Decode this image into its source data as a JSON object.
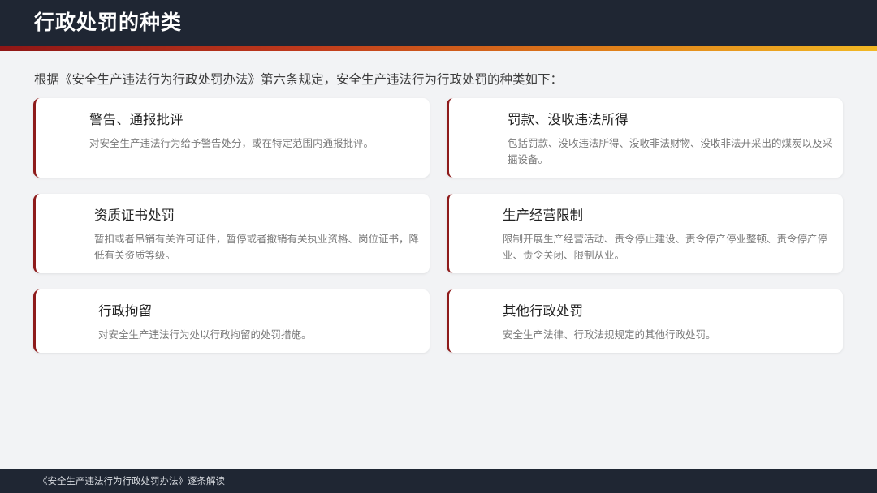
{
  "header": {
    "title": "行政处罚的种类"
  },
  "intro": {
    "text": "根据《安全生产违法行为行政处罚办法》第六条规定，安全生产违法行为行政处罚的种类如下："
  },
  "cards": [
    {
      "title": "警告、通报批评",
      "desc": "对安全生产违法行为给予警告处分，或在特定范围内通报批评。"
    },
    {
      "title": "罚款、没收违法所得",
      "desc": "包括罚款、没收违法所得、没收非法财物、没收非法开采出的煤炭以及采掘设备。"
    },
    {
      "title": "资质证书处罚",
      "desc": "暂扣或者吊销有关许可证件，暂停或者撤销有关执业资格、岗位证书，降低有关资质等级。"
    },
    {
      "title": "生产经营限制",
      "desc": "限制开展生产经营活动、责令停止建设、责令停产停业整顿、责令停产停业、责令关闭、限制从业。"
    },
    {
      "title": "行政拘留",
      "desc": "对安全生产违法行为处以行政拘留的处罚措施。"
    },
    {
      "title": "其他行政处罚",
      "desc": "安全生产法律、行政法规规定的其他行政处罚。"
    }
  ],
  "footer": {
    "text": "《安全生产违法行为行政处罚办法》逐条解读"
  },
  "colors": {
    "header_bg": "#1f2633",
    "accent_red": "#8e1b1b",
    "accent_gold": "#f2b824",
    "page_bg": "#f2f3f5"
  }
}
